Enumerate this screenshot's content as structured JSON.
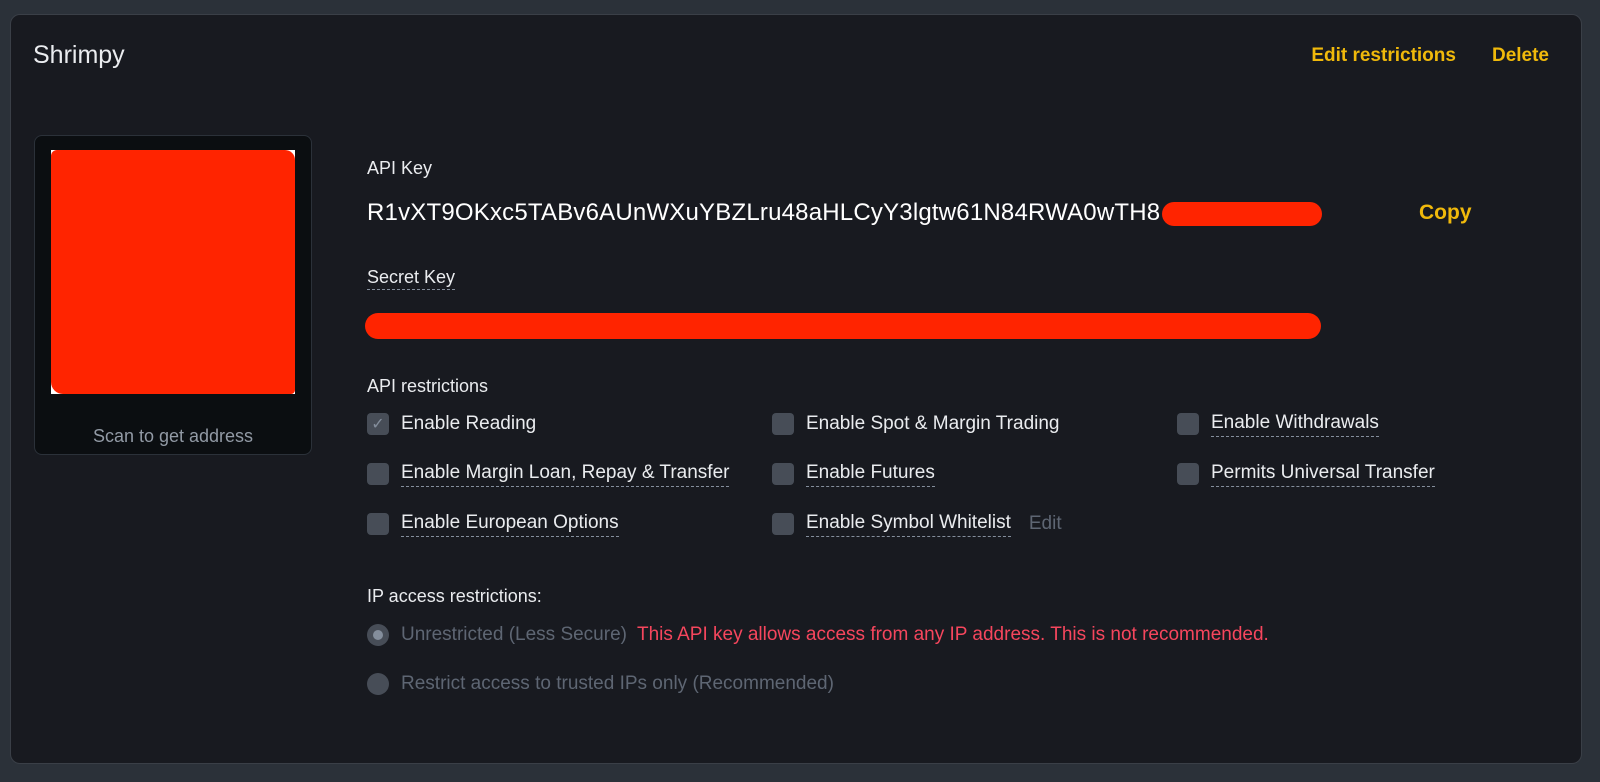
{
  "header": {
    "title": "Shrimpy",
    "edit_restrictions_label": "Edit restrictions",
    "delete_label": "Delete"
  },
  "qr": {
    "caption": "Scan to get address",
    "redaction_color": "#ff2400"
  },
  "api_key": {
    "label": "API Key",
    "value": "R1vXT9OKxc5TABv6AUnWXuYBZLru48aHLCyY3lgtw61N84RWA0wTH8",
    "copy_label": "Copy"
  },
  "secret_key": {
    "label": "Secret Key"
  },
  "restrictions": {
    "label": "API restrictions",
    "items": [
      {
        "label": "Enable Reading",
        "checked": true
      },
      {
        "label": "Enable Spot & Margin Trading",
        "checked": false
      },
      {
        "label": "Enable Withdrawals",
        "checked": false
      },
      {
        "label": "Enable Margin Loan, Repay & Transfer",
        "checked": false
      },
      {
        "label": "Enable Futures",
        "checked": false
      },
      {
        "label": "Permits Universal Transfer",
        "checked": false
      },
      {
        "label": "Enable European Options",
        "checked": false
      },
      {
        "label": "Enable Symbol Whitelist",
        "checked": false
      }
    ],
    "whitelist_edit_label": "Edit"
  },
  "ip_access": {
    "label": "IP access restrictions:",
    "options": [
      {
        "label": "Unrestricted (Less Secure)",
        "selected": true
      },
      {
        "label": "Restrict access to trusted IPs only (Recommended)",
        "selected": false
      }
    ],
    "warning": "This API key allows access from any IP address. This is not recommended."
  },
  "colors": {
    "accent": "#f0b90b",
    "warning": "#f6465d",
    "background": "#181a20",
    "redaction": "#ff2400"
  }
}
